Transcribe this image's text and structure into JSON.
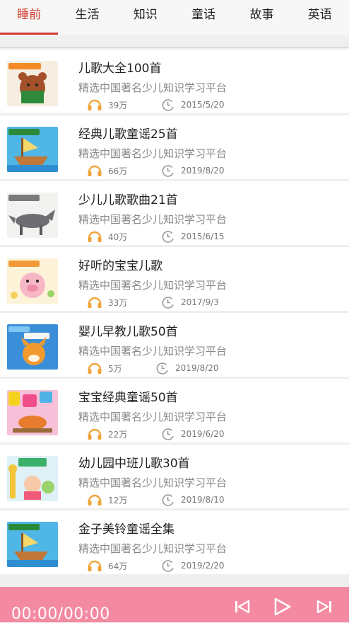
{
  "tabs": [
    {
      "label": "睡前",
      "active": true
    },
    {
      "label": "生活",
      "active": false
    },
    {
      "label": "知识",
      "active": false
    },
    {
      "label": "童话",
      "active": false
    },
    {
      "label": "故事",
      "active": false
    },
    {
      "label": "英语",
      "active": false
    }
  ],
  "items": [
    {
      "title": "儿歌大全100首",
      "subtitle": "精选中国著名少儿知识学习平台",
      "plays": "39万",
      "date": "2015/5/20",
      "cover_icon": "bear-cover-icon"
    },
    {
      "title": "经典儿歌童谣25首",
      "subtitle": "精选中国著名少儿知识学习平台",
      "plays": "66万",
      "date": "2019/8/20",
      "cover_icon": "boat-cover-icon"
    },
    {
      "title": "少儿儿歌歌曲21首",
      "subtitle": "精选中国著名少儿知识学习平台",
      "plays": "40万",
      "date": "2015/6/15",
      "cover_icon": "wolf-cover-icon"
    },
    {
      "title": "好听的宝宝儿歌",
      "subtitle": "精选中国著名少儿知识学习平台",
      "plays": "33万",
      "date": "2017/9/3",
      "cover_icon": "pig-cover-icon"
    },
    {
      "title": "婴儿早教儿歌50首",
      "subtitle": "精选中国著名少儿知识学习平台",
      "plays": "5万",
      "date": "2019/8/20",
      "cover_icon": "fox-cover-icon"
    },
    {
      "title": "宝宝经典童谣50首",
      "subtitle": "精选中国著名少儿知识学习平台",
      "plays": "22万",
      "date": "2019/6/20",
      "cover_icon": "horse-cover-icon"
    },
    {
      "title": "幼儿园中班儿歌30首",
      "subtitle": "精选中国著名少儿知识学习平台",
      "plays": "12万",
      "date": "2019/8/10",
      "cover_icon": "giraffe-cover-icon"
    },
    {
      "title": "金子美铃童谣全集",
      "subtitle": "精选中国著名少儿知识学习平台",
      "plays": "64万",
      "date": "2019/2/20",
      "cover_icon": "boat-cover-icon"
    }
  ],
  "player": {
    "time": "00:00/00:00",
    "icons": [
      "previous-icon",
      "play-icon",
      "next-icon"
    ]
  },
  "colors": {
    "accent": "#d13b2e",
    "player_bg": "#f48aa2",
    "headphone": "#f0a53a"
  }
}
